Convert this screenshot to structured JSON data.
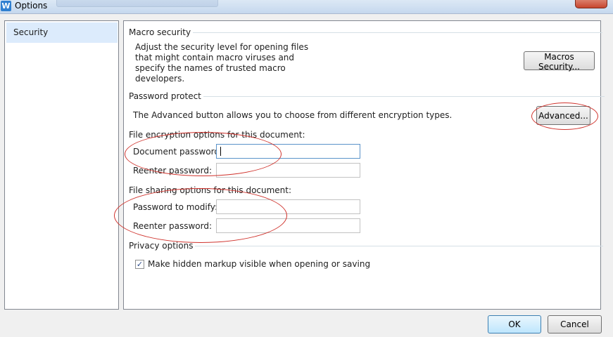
{
  "window": {
    "title": "Options"
  },
  "sidebar": {
    "items": [
      {
        "label": "Security"
      }
    ]
  },
  "macro": {
    "heading": "Macro security",
    "desc_lines": [
      "Adjust the security level for opening files",
      "that might contain macro viruses and",
      "specify the names of trusted macro",
      "developers."
    ],
    "button_label": "Macros Security..."
  },
  "password": {
    "heading": "Password protect",
    "desc": "The Advanced button allows you to choose from different encryption types.",
    "advanced_label": "Advanced...",
    "encryption_heading": "File encryption options for this document:",
    "doc_password_label": "Document password:",
    "doc_password_value": "",
    "reenter_label": "Reenter password:",
    "reenter_value": "",
    "sharing_heading": "File sharing options for this document:",
    "modify_label": "Password to modify:",
    "modify_value": "",
    "reenter2_label": "Reenter password:",
    "reenter2_value": ""
  },
  "privacy": {
    "heading": "Privacy options",
    "checkbox_label": "Make hidden markup visible when opening or saving",
    "checked": true
  },
  "footer": {
    "ok_label": "OK",
    "cancel_label": "Cancel"
  },
  "colors": {
    "annotation": "#d0332d",
    "selection": "#dcebfc"
  }
}
